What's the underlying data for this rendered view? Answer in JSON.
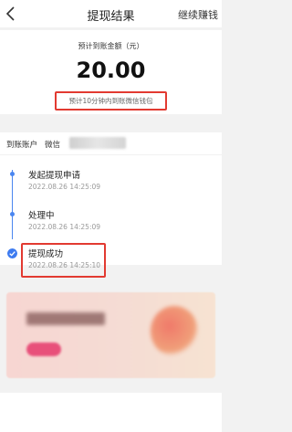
{
  "nav": {
    "title": "提现结果",
    "right_action": "继续赚钱"
  },
  "summary": {
    "label": "预计到账金额（元）",
    "amount": "20.00",
    "note": "预计10分钟内到账微信钱包"
  },
  "account": {
    "label": "到账账户",
    "channel": "微信"
  },
  "steps": [
    {
      "name": "发起提现申请",
      "time": "2022.08.26 14:25:09"
    },
    {
      "name": "处理中",
      "time": "2022.08.26 14:25:09"
    },
    {
      "name": "提现成功",
      "time": "2022.08.26 14:25:10"
    }
  ],
  "colors": {
    "accent": "#3d7bf0",
    "highlight_border": "#e23a31"
  }
}
